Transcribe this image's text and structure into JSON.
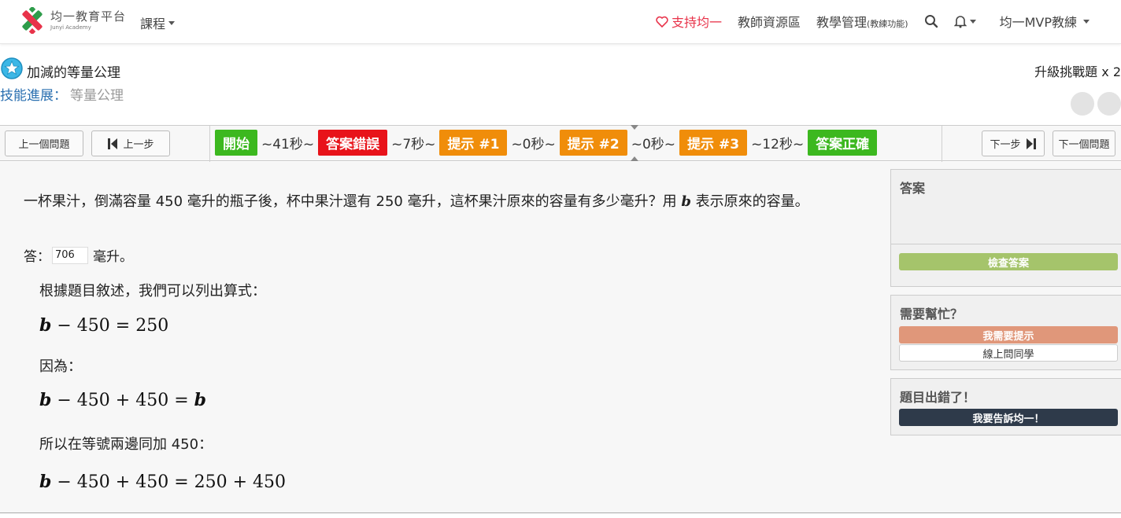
{
  "nav": {
    "logo_cn": "均一教育平台",
    "logo_en": "Junyi Academy",
    "courses": "課程",
    "support": "支持均一",
    "teacher_resources": "教師資源區",
    "teaching_mgmt": "教學管理",
    "teaching_mgmt_note": "(教練功能)",
    "user": "均一MVP教練"
  },
  "skill": {
    "title": "加減的等量公理",
    "upgrade": "升級挑戰題 x 2",
    "progress_label": "技能進展：",
    "progress_value": "等量公理"
  },
  "timeline": {
    "prev_problem": "上一個問題",
    "prev_step": "上一步",
    "next_step": "下一步",
    "next_problem": "下一個問題",
    "steps": [
      {
        "label": "開始",
        "color": "#3cb81f"
      },
      {
        "label": "~41秒~"
      },
      {
        "label": "答案錯誤",
        "color": "#e8131a"
      },
      {
        "label": "~7秒~"
      },
      {
        "label": "提示 #1",
        "color": "#f08d0a"
      },
      {
        "label": "~0秒~"
      },
      {
        "label": "提示 #2",
        "color": "#f08d0a"
      },
      {
        "label": "~0秒~"
      },
      {
        "label": "提示 #3",
        "color": "#f08d0a"
      },
      {
        "label": "~12秒~"
      },
      {
        "label": "答案正確",
        "color": "#3cb81f"
      }
    ]
  },
  "problem": {
    "text_a": "一杯果汁，倒滿容量 450 毫升的瓶子後，杯中果汁還有 250 毫升，這杯果汁原來的容量有多少毫升？用 ",
    "var": "b",
    "text_b": " 表示原來的容量。",
    "answer_prefix": "答：",
    "answer_value": "706",
    "answer_suffix": "毫升。"
  },
  "hints": {
    "h1": "根據題目敘述，我們可以列出算式：",
    "eq1_rest": " − 450 = 250",
    "h2": "因為：",
    "eq2_rest": " − 450 + 450 = ",
    "h3": "所以在等號兩邊同加 450：",
    "eq3_rest": " − 450 + 450 = 250 + 450"
  },
  "side": {
    "answer_title": "答案",
    "check_button": "檢查答案",
    "help_title": "需要幫忙？",
    "hint_button": "我需要提示",
    "ask_button": "線上問同學",
    "report_title": "題目出錯了！",
    "report_button": "我要告訴均一！"
  },
  "colors": {
    "brand_red": "#e8334a",
    "progress_blue": "#2a6fb0",
    "check_green": "#a5c46b",
    "hint_orange": "#e0977a",
    "report_dark": "#2e3a4a"
  }
}
